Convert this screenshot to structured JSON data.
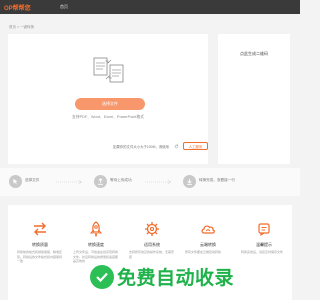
{
  "header": {
    "logo": "OP帮帮您",
    "nav_home": "首页"
  },
  "breadcrumb": "首页 > 一键转换",
  "upload": {
    "button_label": "选择文件",
    "formats_note": "支持PDF、Word、Excel、PowerPoint格式",
    "size_note": "如果你的文件大小大于100M，请使用",
    "manual_label": "人工服务"
  },
  "qr": {
    "title": "点此生成二维码"
  },
  "steps": [
    {
      "label": "选择文件",
      "icon": "cursor-icon"
    },
    {
      "label": "等待上传成功",
      "icon": "upload-icon"
    },
    {
      "label": "转换完成，查看接一行",
      "icon": "download-icon"
    }
  ],
  "features": [
    {
      "title": "转换质量",
      "desc": "转换前的格式和排版保留，精准还原。转换后的文件格式和内容保持一致",
      "icon": "arrows-icon",
      "color": "#f26c2b"
    },
    {
      "title": "转换速度",
      "desc": "上传文件后，可快速在线实现转换文件，并且转换后的质量和速度都是高效的",
      "icon": "rocket-icon",
      "color": "#f26c2b"
    },
    {
      "title": "适用系统",
      "desc": "支持所有常见的操作系统，无需安装",
      "icon": "gear-icon",
      "color": "#f26c2b"
    },
    {
      "title": "云端转换",
      "desc": "所有文件都在云端自动转换",
      "icon": "cloud-icon",
      "color": "#f26c2b"
    },
    {
      "title": "温馨提示",
      "desc": "转换完成后，请您及时保存文件",
      "icon": "bell-icon",
      "color": "#f26c2b"
    }
  ],
  "watermark": {
    "text": "免费自动收录"
  },
  "colors": {
    "accent": "#f26c2b",
    "button": "#f7976b",
    "topbar": "#3a3a3a",
    "watermark": "#1fb24a"
  }
}
